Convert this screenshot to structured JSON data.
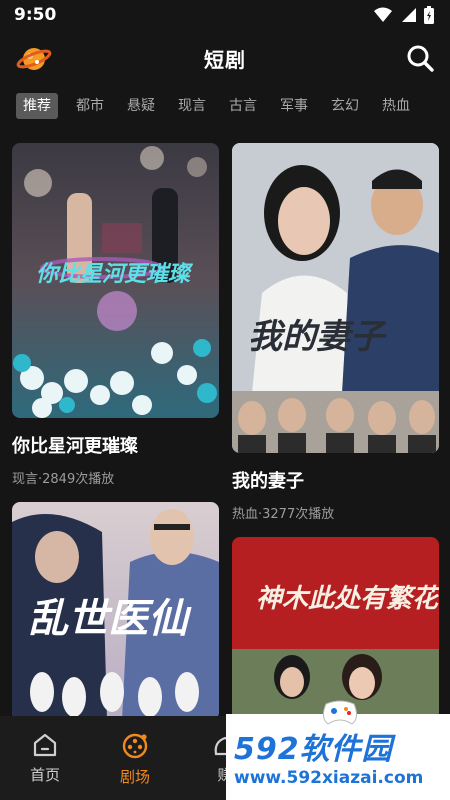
{
  "status_bar": {
    "time": "9:50"
  },
  "header": {
    "title": "短剧"
  },
  "tabs": [
    "推荐",
    "都市",
    "悬疑",
    "现言",
    "古言",
    "军事",
    "玄幻",
    "热血"
  ],
  "cards": [
    {
      "title": "你比星河更璀璨",
      "meta": "现言·2849次播放",
      "poster_text": "你比星河更璀璨"
    },
    {
      "title": "我的妻子",
      "meta": "热血·3277次播放",
      "poster_text": "我的妻子"
    },
    {
      "title": "",
      "meta": "",
      "poster_text": "乱世医仙"
    },
    {
      "title": "",
      "meta": "",
      "poster_text": "神木此处有繁花"
    }
  ],
  "bottom_nav": [
    {
      "label": "首页",
      "icon": "home-icon"
    },
    {
      "label": "剧场",
      "icon": "theater-icon"
    },
    {
      "label": "赚",
      "icon": "earn-icon"
    }
  ],
  "watermark": {
    "brand": "592软件园",
    "url": "www.592xiazai.com"
  },
  "colors": {
    "background": "#151515",
    "accent": "#f08a1c",
    "watermark_blue": "#1d73d8"
  }
}
